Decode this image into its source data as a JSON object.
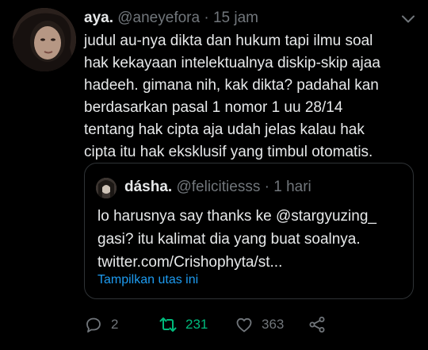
{
  "tweet": {
    "name": "aya.",
    "handle": "@aneyefora",
    "separator": "·",
    "time": "15 jam",
    "text": "judul au-nya dikta dan hukum tapi ilmu soal\nhak kekayaan intelektualnya diskip-skip ajaa\nhadeeh. gimana nih, kak dikta? padahal kan\nberdasarkan pasal 1 nomor 1 uu 28/14\ntentang hak cipta aja udah jelas kalau hak\ncipta itu hak eksklusif yang timbul otomatis.",
    "more_icon": "chevron-down-icon"
  },
  "quote": {
    "name": "dásha.",
    "handle": "@felicitiesss",
    "separator": "·",
    "time": "1 hari",
    "text": "lo harusnya say thanks ke @stargyuzing_\ngasi? itu kalimat dia yang buat soalnya.\ntwitter.com/Crishophyta/st...",
    "show_thread": "Tampilkan utas ini"
  },
  "actions": {
    "reply": {
      "icon": "reply-icon",
      "count": "2"
    },
    "retweet": {
      "icon": "retweet-icon",
      "count": "231",
      "active": true
    },
    "like": {
      "icon": "heart-icon",
      "count": "363"
    },
    "share": {
      "icon": "share-icon"
    }
  },
  "colors": {
    "background": "#000000",
    "text": "#e7e9ea",
    "muted": "#71767b",
    "link": "#1d9bf0",
    "retweet_active": "#00ba7c",
    "border": "#2f3336"
  }
}
